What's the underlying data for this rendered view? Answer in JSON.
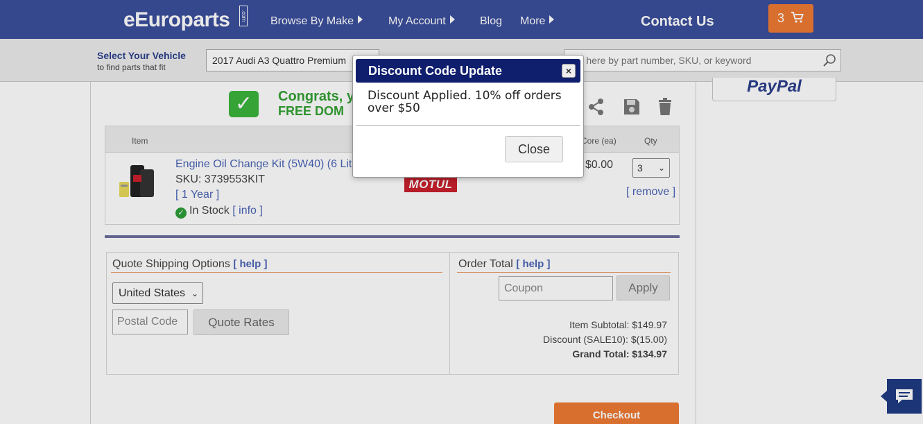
{
  "header": {
    "logo": "eEuroparts",
    "logo_suffix": ".com",
    "nav": [
      {
        "label": "Browse By Make",
        "has_caret": true
      },
      {
        "label": "My Account",
        "has_caret": true
      },
      {
        "label": "Blog",
        "has_caret": false
      },
      {
        "label": "More",
        "has_caret": true
      }
    ],
    "contact": "Contact Us",
    "cart_count": "3",
    "accent_color": "#ef7b33",
    "bar_color": "#3b4f9c"
  },
  "vehicle": {
    "title": "Select Your Vehicle",
    "subtitle": "to find parts that fit",
    "selected": "2017 Audi A3 Quattro Premium"
  },
  "search": {
    "placeholder": "Search here by part number, SKU, or keyword",
    "visible_text": "rch here by part number, SKU, or keyword"
  },
  "paypal": "PayPal",
  "congrats": {
    "line1": "Congrats, y",
    "line2": "FREE DOM"
  },
  "cart": {
    "columns": {
      "item": "Item",
      "core": "Core (ea)",
      "qty": "Qty"
    },
    "items": [
      {
        "name": "Engine Oil Change Kit (5W40) (6 Lite",
        "sku": "SKU: 3739553KIT",
        "warranty": "[ 1 Year ]",
        "stock": "In Stock",
        "info": "[ info ]",
        "brand": "MOTUL",
        "core": "$0.00",
        "qty": "3",
        "remove": "[ remove ]"
      }
    ]
  },
  "shipping": {
    "title": "Quote Shipping Options",
    "help": "[ help ]",
    "country": "United States",
    "postal_placeholder": "Postal Code",
    "quote_button": "Quote Rates"
  },
  "order_total": {
    "title": "Order Total",
    "help": "[ help ]",
    "coupon_placeholder": "Coupon",
    "apply_button": "Apply",
    "rows": [
      {
        "label": "Item Subtotal:",
        "value": "$149.97",
        "bold": false
      },
      {
        "label": "Discount (SALE10):",
        "value": "$(15.00)",
        "bold": false
      },
      {
        "label": "Grand Total:",
        "value": "$134.97",
        "bold": true
      }
    ]
  },
  "checkout_label": "Checkout",
  "modal": {
    "title": "Discount Code Update",
    "close_x": "×",
    "body": "Discount Applied. 10% off orders over $50",
    "close_button": "Close",
    "header_color": "#0f1f6e"
  }
}
